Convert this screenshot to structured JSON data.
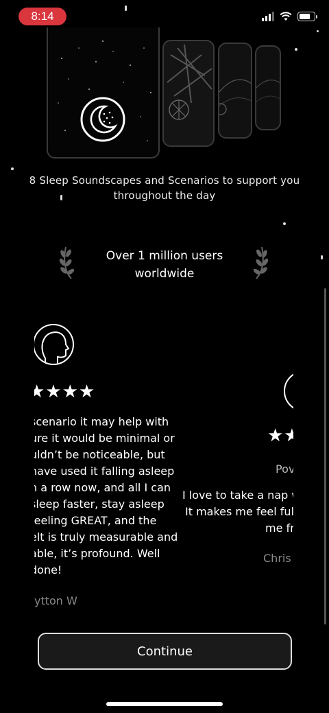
{
  "status_bar": {
    "time": "8:14",
    "battery_level": 0.75
  },
  "hero": {
    "caption": "8 Sleep Soundscapes and Scenarios to support you throughout the day",
    "icon": "moon-icon"
  },
  "social_proof": {
    "headline": "Over 1 million users worldwide"
  },
  "reviews": [
    {
      "stars": "★★★★",
      "text_lines": [
        "scenario it may help with",
        "ure it would be minimal or",
        "uldn’t be noticeable, but",
        " have used it falling asleep",
        "n a row now, and all I can",
        "sleep faster, stay asleep",
        "feeling GREAT, and the",
        "elt is truly measurable and",
        "able, it’s profound. Well",
        "done!"
      ],
      "author": "ytton W"
    },
    {
      "stars": "★★",
      "title": "Pov",
      "text_lines": [
        "I love to take a nap w",
        "It makes me feel full",
        "me fr"
      ],
      "author": "Chris"
    }
  ],
  "cta": {
    "label": "Continue"
  }
}
